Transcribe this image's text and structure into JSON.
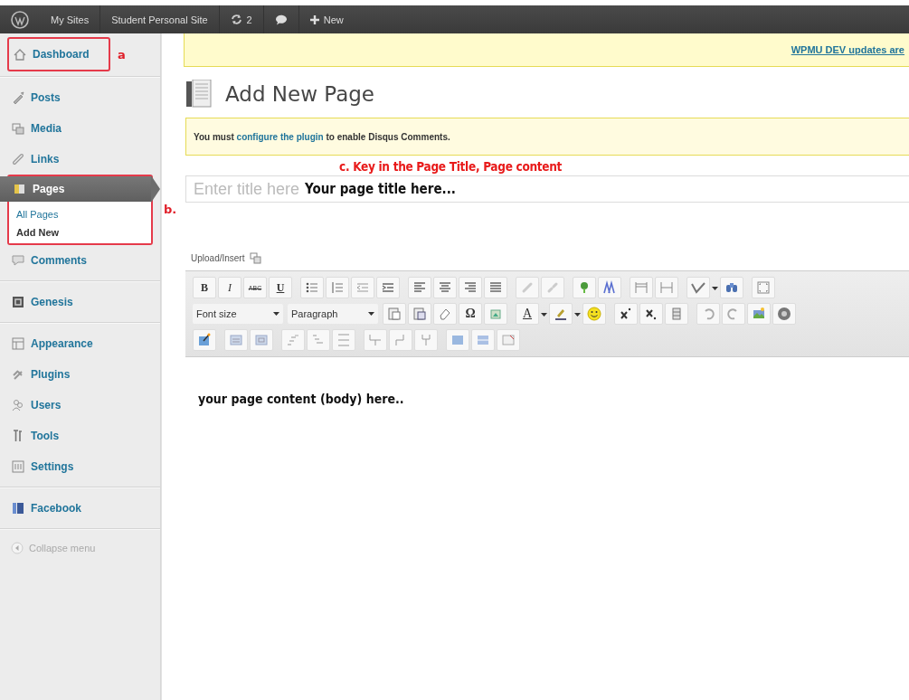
{
  "admin_bar": {
    "items": [
      "My Sites",
      "Student Personal Site",
      "2",
      "New"
    ]
  },
  "sidebar": {
    "groups": [
      [
        {
          "label": "Dashboard",
          "selected": false,
          "annotated": true,
          "note": "a"
        }
      ],
      [
        {
          "label": "Posts",
          "selected": false
        },
        {
          "label": "Media",
          "selected": false
        },
        {
          "label": "Links",
          "selected": false
        },
        {
          "label": "Pages",
          "selected": true,
          "annotated": true,
          "note": "b.",
          "children": [
            {
              "label": "All Pages",
              "selected": false
            },
            {
              "label": "Add New",
              "selected": true
            }
          ]
        },
        {
          "label": "Comments",
          "selected": false
        }
      ],
      [
        {
          "label": "Genesis",
          "selected": false
        }
      ],
      [
        {
          "label": "Appearance",
          "selected": false
        },
        {
          "label": "Plugins",
          "selected": false
        },
        {
          "label": "Users",
          "selected": false
        },
        {
          "label": "Tools",
          "selected": false
        },
        {
          "label": "Settings",
          "selected": false
        }
      ],
      [
        {
          "label": "Facebook",
          "selected": false
        }
      ]
    ],
    "collapse": "Collapse menu"
  },
  "update_notice": {
    "link": "WPMU DEV updates are"
  },
  "page_title": "Add New Page",
  "disqus_notice": {
    "before": "You must",
    "link": "configure the plugin",
    "after": "to enable Disqus Comments."
  },
  "instruction": "c. Key in the Page Title, Page content",
  "title_field": {
    "placeholder": "Enter title here",
    "example": "Your page title here..."
  },
  "upload_insert": "Upload/Insert",
  "toolbar": {
    "glyphs": [
      "B",
      "I",
      "ABC",
      "U",
      "Ω",
      "A"
    ],
    "selects": [
      "Font size",
      "Paragraph"
    ]
  },
  "content_example": "your page content (body) here.."
}
